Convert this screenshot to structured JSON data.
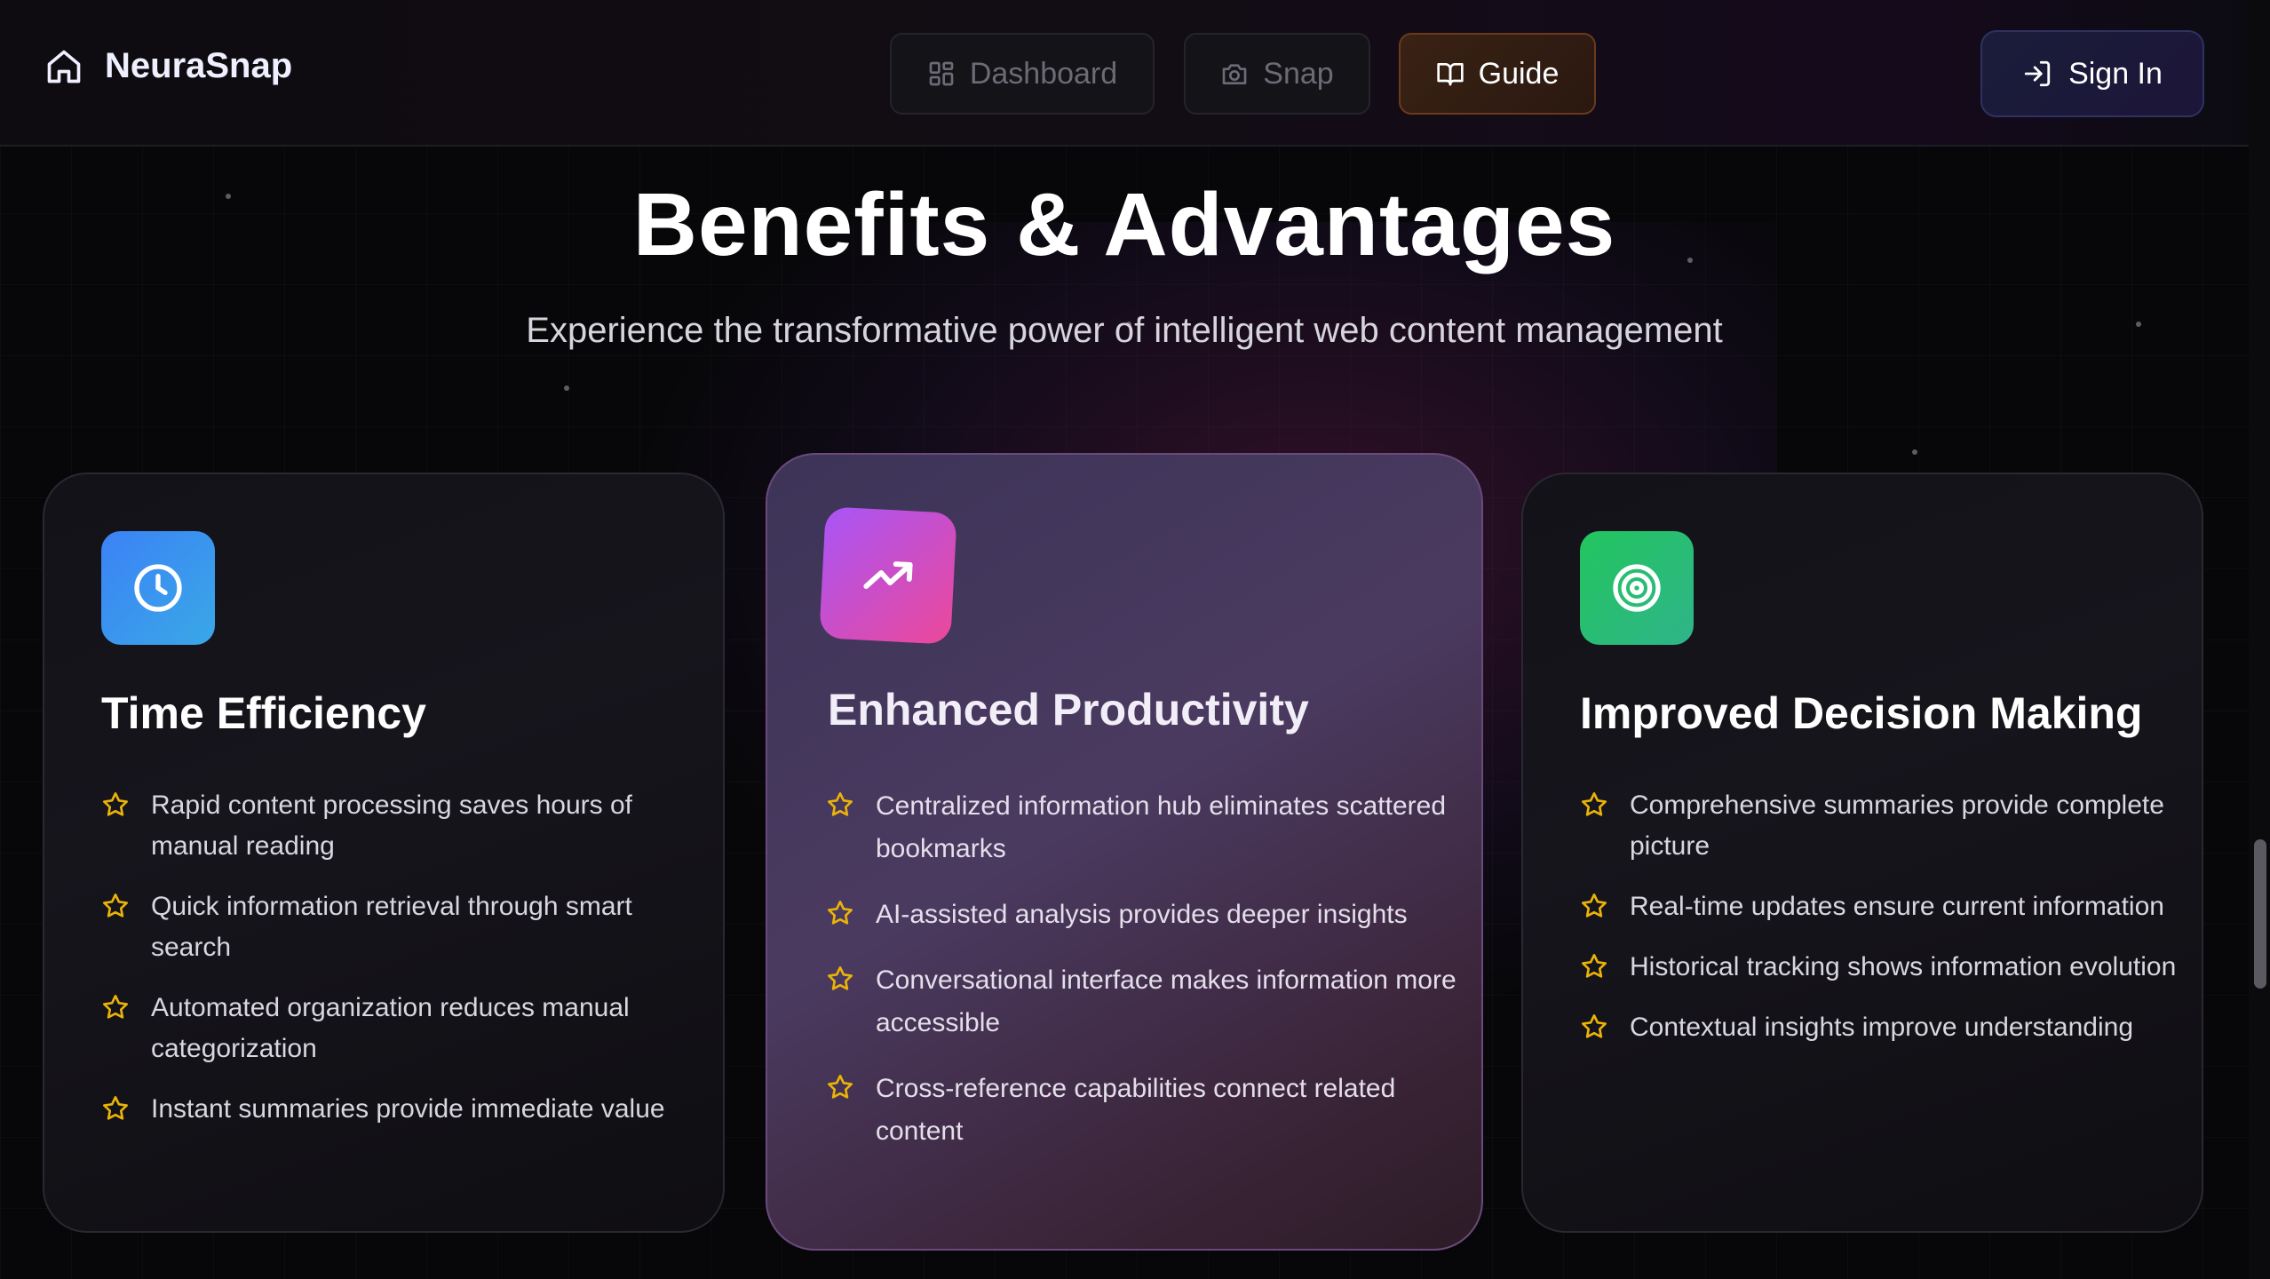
{
  "brand": {
    "name": "NeuraSnap",
    "icon": "home-icon"
  },
  "nav": {
    "dashboard": {
      "label": "Dashboard",
      "icon": "grid-icon"
    },
    "snap": {
      "label": "Snap",
      "icon": "camera-icon"
    },
    "guide": {
      "label": "Guide",
      "icon": "book-icon",
      "active": true
    },
    "signin": {
      "label": "Sign In",
      "icon": "login-icon"
    }
  },
  "section": {
    "title": "Benefits & Advantages",
    "subtitle": "Experience the transformative power of intelligent web content management"
  },
  "cards": [
    {
      "title": "Time Efficiency",
      "icon": "clock-icon",
      "accent": "#3b82f6",
      "points": [
        "Rapid content processing saves hours of manual reading",
        "Quick information retrieval through smart search",
        "Automated organization reduces manual categorization",
        "Instant summaries provide immediate value"
      ]
    },
    {
      "title": "Enhanced Productivity",
      "icon": "trending-up-icon",
      "accent": "#a855f7",
      "points": [
        "Centralized information hub eliminates scattered bookmarks",
        "AI-assisted analysis provides deeper insights",
        "Conversational interface makes information more accessible",
        "Cross-reference capabilities connect related content"
      ]
    },
    {
      "title": "Improved Decision Making",
      "icon": "target-icon",
      "accent": "#22c55e",
      "points": [
        "Comprehensive summaries provide complete picture",
        "Real-time updates ensure current information",
        "Historical tracking shows information evolution",
        "Contextual insights improve understanding"
      ]
    }
  ],
  "colors": {
    "star": "#eab308",
    "background": "#070709"
  }
}
